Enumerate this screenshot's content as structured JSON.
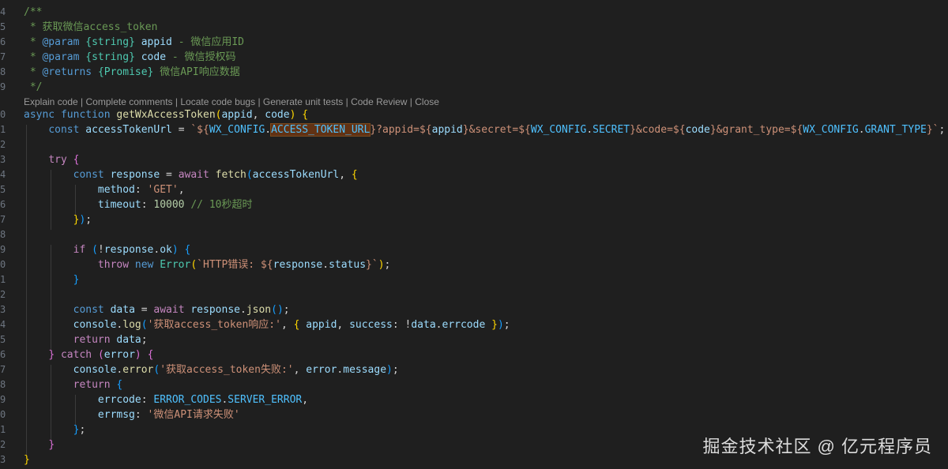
{
  "gutter": [
    "4",
    "5",
    "6",
    "7",
    "8",
    "9",
    "",
    "0",
    "1",
    "2",
    "3",
    "4",
    "5",
    "6",
    "7",
    "8",
    "9",
    "0",
    "1",
    "2",
    "3",
    "4",
    "5",
    "6",
    "7",
    "8",
    "9",
    "0",
    "1",
    "2",
    "3"
  ],
  "comment": {
    "open": "/**",
    "l1_prefix": " * ",
    "l1_text": "获取微信access_token",
    "param1_tag": "@param",
    "param1_type": "{string}",
    "param1_name": "appid",
    "param1_desc": " - 微信应用ID",
    "param2_tag": "@param",
    "param2_type": "{string}",
    "param2_name": "code",
    "param2_desc": " - 微信授权码",
    "returns_tag": "@returns",
    "returns_type": "{Promise}",
    "returns_desc": " 微信API响应数据",
    "close": " */"
  },
  "codelens": {
    "items": [
      "Explain code",
      "Complete comments",
      "Locate code bugs",
      "Generate unit tests",
      "Code Review",
      "Close"
    ],
    "separator": " | "
  },
  "code": {
    "async": "async",
    "function": "function",
    "fn_name": "getWxAccessToken",
    "p_appid": "appid",
    "p_code": "code",
    "const": "const",
    "url_var": "accessTokenUrl",
    "wx_config": "WX_CONFIG",
    "access_token_url": "ACCESS_TOKEN_URL",
    "q_appid": "?appid=",
    "appid": "appid",
    "q_secret": "&secret=",
    "secret": "SECRET",
    "q_code": "&code=",
    "code_var": "code",
    "q_grant": "&grant_type=",
    "grant_type": "GRANT_TYPE",
    "try": "try",
    "response": "response",
    "await": "await",
    "fetch": "fetch",
    "method_key": "method",
    "method_val": "'GET'",
    "timeout_key": "timeout",
    "timeout_val": "10000",
    "timeout_comment": "// 10秒超时",
    "if": "if",
    "ok": "ok",
    "throw": "throw",
    "new": "new",
    "error_class": "Error",
    "http_err_prefix": "`HTTP错误: ",
    "status": "status",
    "data": "data",
    "json": "json",
    "console": "console",
    "log": "log",
    "log_str": "'获取access_token响应:'",
    "success": "success",
    "errcode": "errcode",
    "return": "return",
    "catch": "catch",
    "error": "error",
    "error_fn": "error",
    "err_str": "'获取access_token失败:'",
    "message": "message",
    "errcode_key": "errcode",
    "error_codes": "ERROR_CODES",
    "server_error": "SERVER_ERROR",
    "errmsg_key": "errmsg",
    "errmsg_val": "'微信API请求失败'"
  },
  "watermark": "掘金技术社区 @ 亿元程序员"
}
